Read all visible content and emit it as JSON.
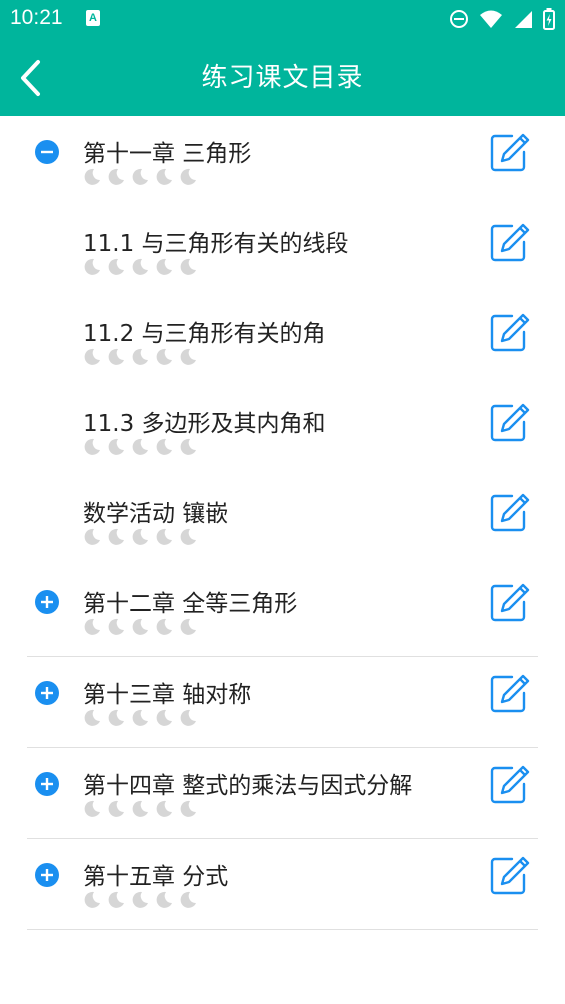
{
  "status_bar": {
    "time": "10:21",
    "notification_letter": "A"
  },
  "header": {
    "title": "练习课文目录"
  },
  "colors": {
    "primary": "#00b59c",
    "accent_blue": "#1a8ff0",
    "moon_gray": "#d6d6d6"
  },
  "moons_per_item": 5,
  "items": [
    {
      "label": "第十一章 三角形",
      "type": "chapter",
      "expanded": true
    },
    {
      "label": "11.1 与三角形有关的线段",
      "type": "section"
    },
    {
      "label": "11.2 与三角形有关的角",
      "type": "section"
    },
    {
      "label": "11.3 多边形及其内角和",
      "type": "section"
    },
    {
      "label": "数学活动 镶嵌",
      "type": "section"
    },
    {
      "label": "第十二章 全等三角形",
      "type": "chapter",
      "expanded": false
    },
    {
      "label": "第十三章 轴对称",
      "type": "chapter",
      "expanded": false
    },
    {
      "label": "第十四章 整式的乘法与因式分解",
      "type": "chapter",
      "expanded": false
    },
    {
      "label": "第十五章 分式",
      "type": "chapter",
      "expanded": false
    }
  ]
}
